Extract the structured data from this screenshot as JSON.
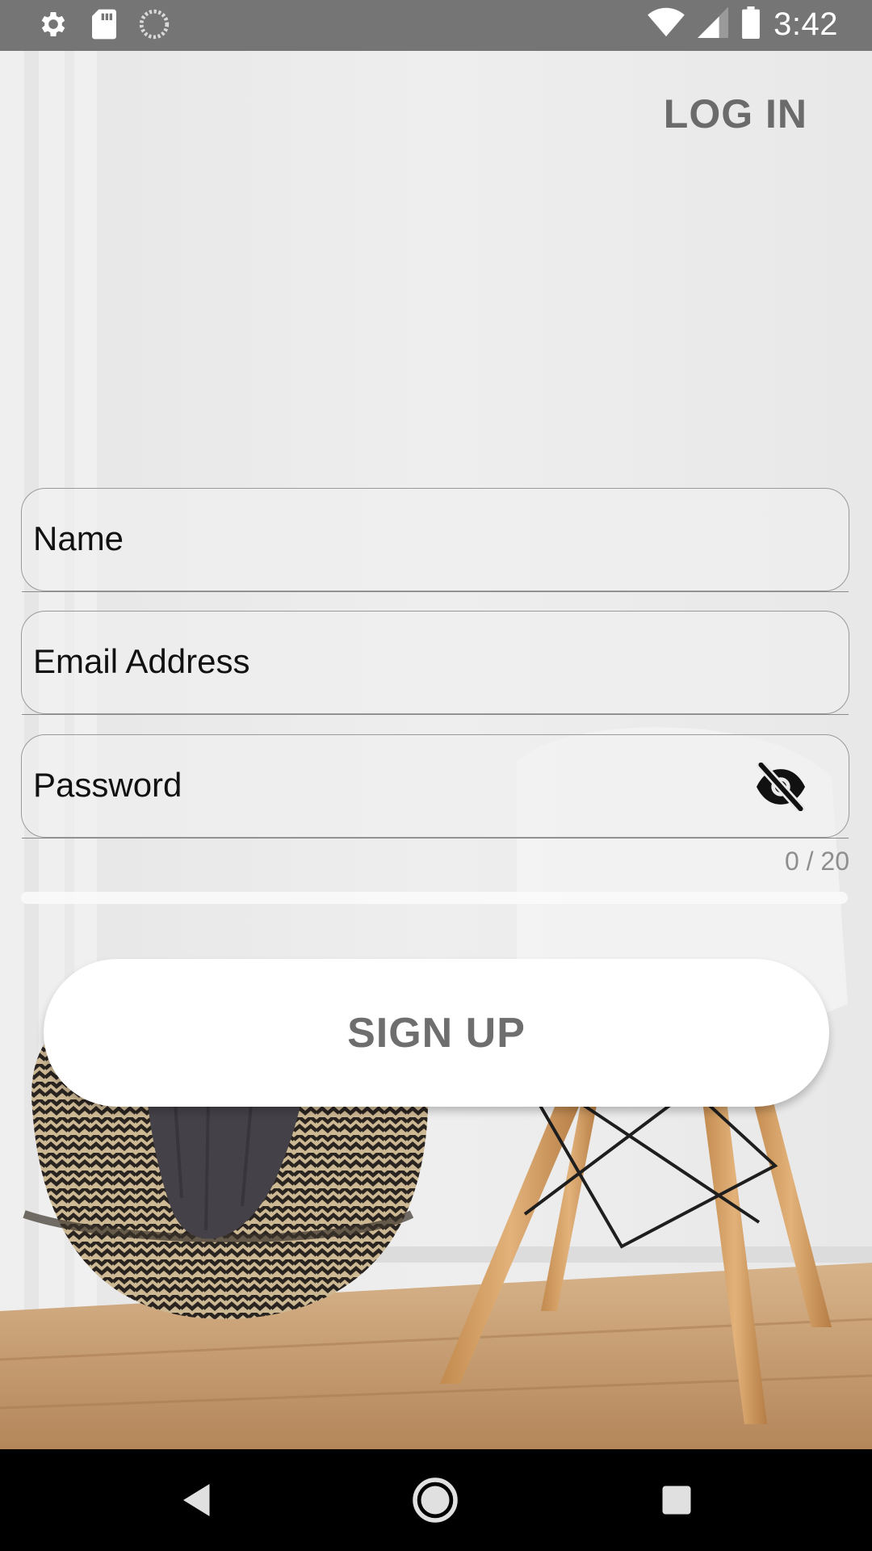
{
  "status_bar": {
    "time": "3:42",
    "left_icons": [
      "settings-icon",
      "sd-card-icon",
      "sync-icon"
    ],
    "right_icons": [
      "wifi-icon",
      "signal-icon",
      "battery-icon"
    ]
  },
  "header": {
    "login_label": "LOG IN"
  },
  "form": {
    "name_placeholder": "Name",
    "email_placeholder": "Email Address",
    "password_placeholder": "Password",
    "password_visibility_icon": "eye-off-icon",
    "password_counter": "0 / 20",
    "password_strength": 0
  },
  "actions": {
    "signup_label": "SIGN UP"
  },
  "nav_bar": {
    "buttons": [
      "back-icon",
      "home-icon",
      "recents-icon"
    ]
  },
  "colors": {
    "status_bar": "#757575",
    "label_text": "#6b6b6b",
    "button_bg": "#ffffff",
    "nav_bar": "#000000"
  }
}
